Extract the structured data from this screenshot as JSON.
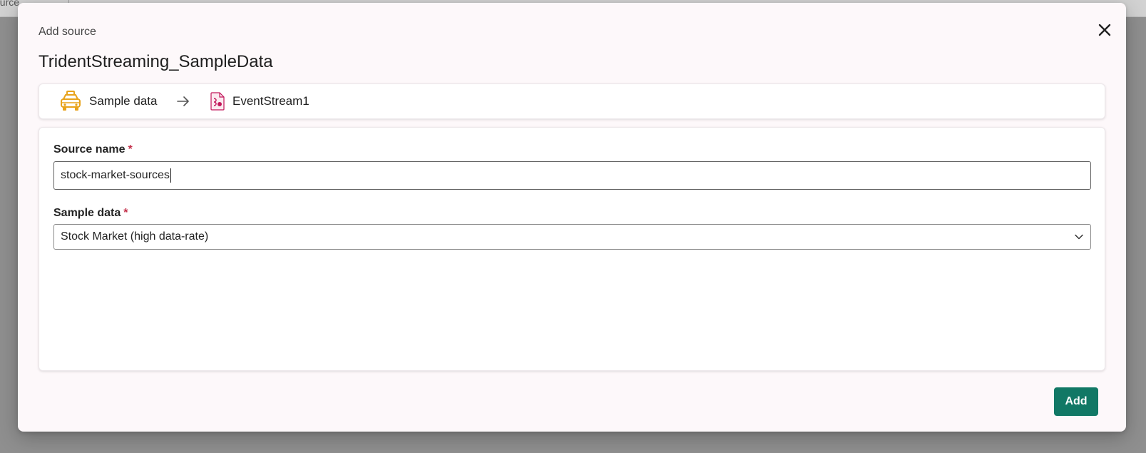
{
  "background": {
    "tab_label": "ource",
    "tab_chevron": "⌄"
  },
  "dialog": {
    "kicker": "Add source",
    "title": "TridentStreaming_SampleData",
    "close_icon": "close-icon"
  },
  "path": {
    "source_label": "Sample data",
    "source_icon": "taxi-icon",
    "arrow_icon": "arrow-right-icon",
    "destination_label": "EventStream1",
    "destination_icon": "eventstream-icon"
  },
  "form": {
    "source_name": {
      "label": "Source name",
      "required_mark": "*",
      "value": "stock-market-sources"
    },
    "sample_data": {
      "label": "Sample data",
      "required_mark": "*",
      "selected": "Stock Market (high data-rate)"
    }
  },
  "actions": {
    "add_label": "Add"
  },
  "colors": {
    "accent": "#117865",
    "required": "#c4314b",
    "taxi_icon": "#e8a31c",
    "eventstream_icon": "#c2185b"
  }
}
